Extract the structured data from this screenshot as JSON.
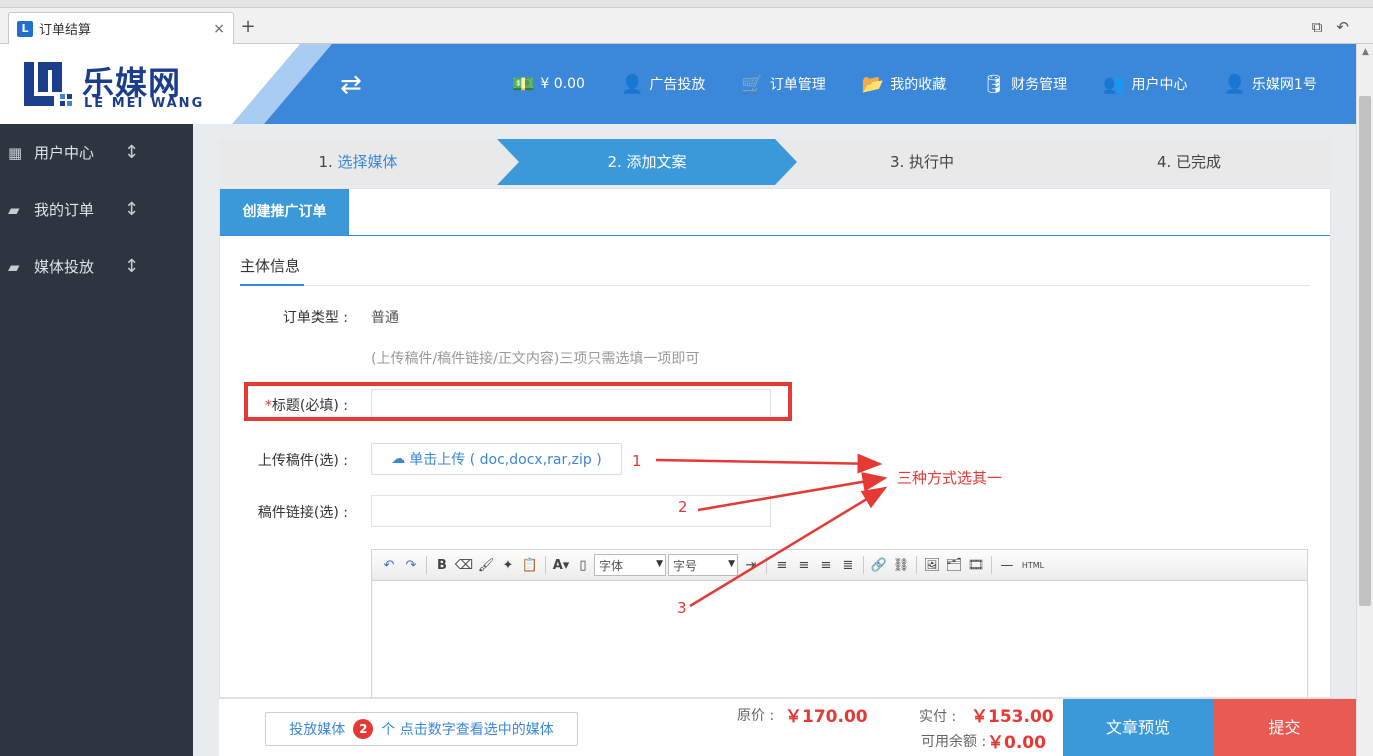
{
  "browser": {
    "tab_title": "订单结算",
    "tab_favicon": "L",
    "tab_close": "×",
    "new_tab": "+"
  },
  "header": {
    "logo_cn": "乐媒网",
    "logo_en": "LE MEI WANG",
    "nav": [
      {
        "icon": "money-icon",
        "glyph": "💵",
        "label": "¥ 0.00"
      },
      {
        "icon": "user-icon",
        "glyph": "👤",
        "label": "广告投放"
      },
      {
        "icon": "cart-icon",
        "glyph": "🛒",
        "label": "订单管理"
      },
      {
        "icon": "folder-icon",
        "glyph": "📂",
        "label": "我的收藏"
      },
      {
        "icon": "database-icon",
        "glyph": "🛢",
        "label": "财务管理"
      },
      {
        "icon": "users-icon",
        "glyph": "👥",
        "label": "用户中心"
      },
      {
        "icon": "user-icon",
        "glyph": "👤",
        "label": "乐媒网1号"
      }
    ]
  },
  "sidebar": {
    "items": [
      {
        "label": "用户中心",
        "icon": "building-icon"
      },
      {
        "label": "我的订单",
        "icon": "book-icon"
      },
      {
        "label": "媒体投放",
        "icon": "book-icon"
      }
    ]
  },
  "steps": {
    "step1_num": "1. ",
    "step1_label": "选择媒体",
    "step2": "2. 添加文案",
    "step3": "3. 执行中",
    "step4": "4. 已完成"
  },
  "panel": {
    "tab": "创建推广订单",
    "section_title": "主体信息",
    "order_type_label": "订单类型 :",
    "order_type_value": "普通",
    "hint": "(上传稿件/稿件链接/正文内容)三项只需选填一项即可",
    "title_label_star": "*",
    "title_label": "标题(必填) :",
    "upload_label": "上传稿件(选) :",
    "upload_button": "单击上传 ( doc,docx,rar,zip )",
    "link_label": "稿件链接(选) :",
    "font_select": "字体",
    "size_select": "字号"
  },
  "annotations": {
    "n1": "1",
    "n2": "2",
    "n3": "3",
    "note": "三种方式选其一",
    "color": "#e53935"
  },
  "footer": {
    "media_prefix": "投放媒体",
    "media_count": "2",
    "media_suffix": "个 点击数字查看选中的媒体",
    "original_label": "原价 :",
    "original_price": "￥170.00",
    "actual_label": "实付 :",
    "actual_price": "￥153.00",
    "balance_label": "可用余额 :",
    "balance_value": "￥0.00",
    "preview_button": "文章预览",
    "submit_button": "提交"
  }
}
